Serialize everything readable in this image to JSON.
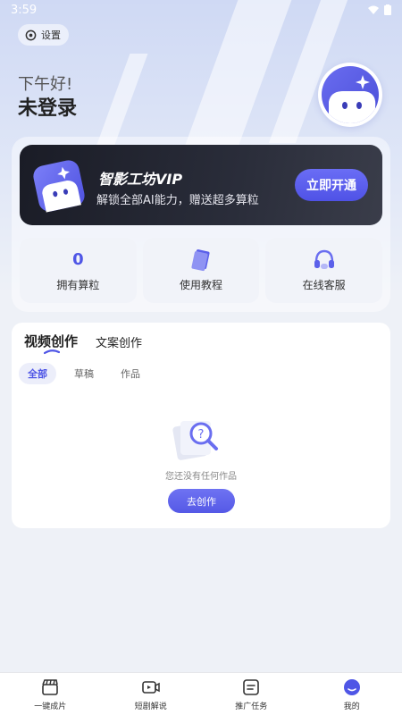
{
  "status_bar": {
    "time": "3:59"
  },
  "header": {
    "settings_label": "设置",
    "greeting": "下午好!",
    "username": "未登录"
  },
  "vip": {
    "title": "智影工坊VIP",
    "subtitle": "解锁全部AI能力，赠送超多算粒",
    "button": "立即开通"
  },
  "quick": {
    "credits_value": "0",
    "credits_label": "拥有算粒",
    "tutorial_label": "使用教程",
    "support_label": "在线客服"
  },
  "works": {
    "tabs": [
      "视频创作",
      "文案创作"
    ],
    "filters": [
      "全部",
      "草稿",
      "作品"
    ],
    "empty_text": "您还没有任何作品",
    "create_button": "去创作"
  },
  "tabbar": {
    "items": [
      "一键成片",
      "短剧解说",
      "推广任务",
      "我的"
    ],
    "active": "我的"
  },
  "colors": {
    "accent": "#4f56e6",
    "vip_bg": "#1a1c26"
  }
}
